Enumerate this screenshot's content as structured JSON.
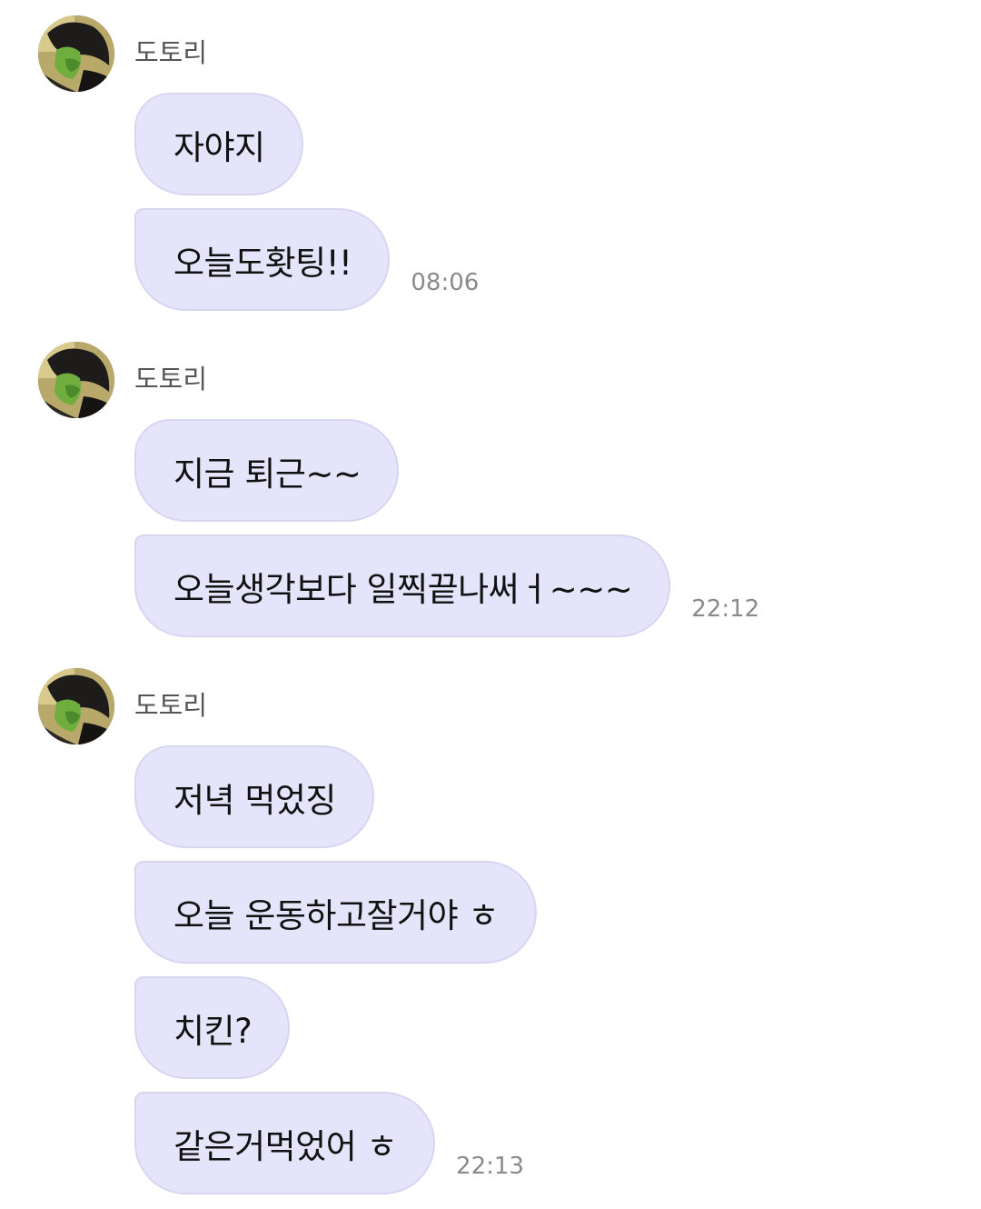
{
  "groups": [
    {
      "sender": "도토리",
      "avatar_icon": "profile-avatar",
      "messages": [
        {
          "text": "자야지",
          "time": ""
        },
        {
          "text": "오늘도홧팅!!",
          "time": "08:06"
        }
      ]
    },
    {
      "sender": "도토리",
      "avatar_icon": "profile-avatar",
      "messages": [
        {
          "text": "지금 퇴근~~",
          "time": ""
        },
        {
          "text": "오늘생각보다 일찍끝나써ㅓ~~~",
          "time": "22:12"
        }
      ]
    },
    {
      "sender": "도토리",
      "avatar_icon": "profile-avatar",
      "messages": [
        {
          "text": "저녁 먹었징",
          "time": ""
        },
        {
          "text": "오늘 운동하고잘거야 ㅎ",
          "time": ""
        },
        {
          "text": "치킨?",
          "time": ""
        },
        {
          "text": "같은거먹었어 ㅎ",
          "time": "22:13"
        }
      ]
    }
  ],
  "colors": {
    "bubble": "#e6e4fb",
    "bubble_border": "#d8d5f3",
    "sender_text": "#555555",
    "time_text": "#8a8a8a"
  }
}
